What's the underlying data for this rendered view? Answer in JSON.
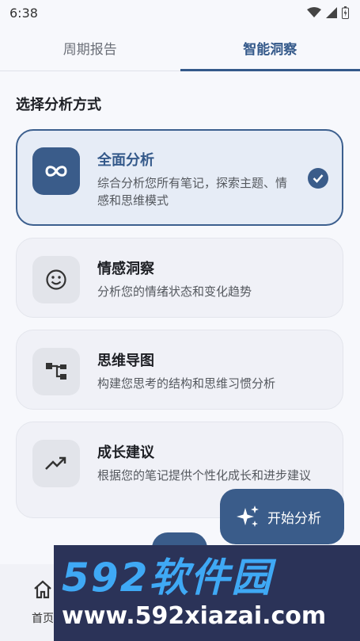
{
  "status_bar": {
    "time": "6:38"
  },
  "tabs": [
    {
      "label": "周期报告",
      "active": false
    },
    {
      "label": "智能洞察",
      "active": true
    }
  ],
  "section_title": "选择分析方式",
  "cards": [
    {
      "title": "全面分析",
      "desc": "综合分析您所有笔记，探索主题、情感和思维模式",
      "icon": "infinity-icon",
      "selected": true
    },
    {
      "title": "情感洞察",
      "desc": "分析您的情绪状态和变化趋势",
      "icon": "smiley-icon",
      "selected": false
    },
    {
      "title": "思维导图",
      "desc": "构建您思考的结构和思维习惯分析",
      "icon": "mindmap-icon",
      "selected": false
    },
    {
      "title": "成长建议",
      "desc": "根据您的笔记提供个性化成长和进步建议",
      "icon": "trending-up-icon",
      "selected": false
    }
  ],
  "fab": {
    "label": "开始分析",
    "icon": "sparkles-icon"
  },
  "bottom_nav": {
    "home_label": "首页"
  },
  "watermark": {
    "logo": "592软件园",
    "url": "www.592xiazai.com"
  },
  "colors": {
    "accent": "#3a5c8a",
    "background": "#f7f8fc"
  }
}
